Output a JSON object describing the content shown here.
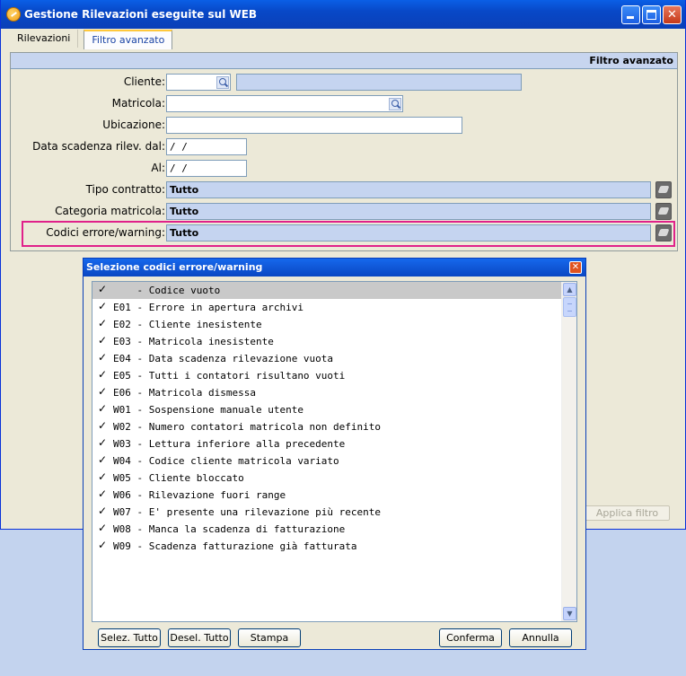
{
  "window": {
    "title": "Gestione Rilevazioni eseguite sul WEB",
    "controls": [
      "minimize",
      "maximize",
      "close"
    ]
  },
  "tabs": [
    {
      "label": "Rilevazioni",
      "active": false
    },
    {
      "label": "Filtro avanzato",
      "active": true
    }
  ],
  "filter_panel": {
    "header": "Filtro avanzato",
    "fields": {
      "cliente": {
        "label": "Cliente:",
        "value": "",
        "description": ""
      },
      "matricola": {
        "label": "Matricola:",
        "value": ""
      },
      "ubicazione": {
        "label": "Ubicazione:",
        "value": ""
      },
      "data_dal": {
        "label": "Data scadenza rilev. dal:",
        "value": "  /  /"
      },
      "al": {
        "label": "Al:",
        "value": "  /  /"
      },
      "tipo_contratto": {
        "label": "Tipo contratto:",
        "value": "Tutto"
      },
      "categoria_matricola": {
        "label": "Categoria matricola:",
        "value": "Tutto"
      },
      "codici_errore": {
        "label": "Codici errore/warning:",
        "value": "Tutto"
      }
    },
    "highlight_color": "#e0218a"
  },
  "apply_button": {
    "label": "Applica filtro",
    "enabled": false
  },
  "dialog": {
    "title": "Selezione codici errore/warning",
    "items": [
      {
        "code": "   ",
        "text": "Codice vuoto",
        "checked": true,
        "selected": true
      },
      {
        "code": "E01",
        "text": "Errore in apertura archivi",
        "checked": true
      },
      {
        "code": "E02",
        "text": "Cliente inesistente",
        "checked": true
      },
      {
        "code": "E03",
        "text": "Matricola inesistente",
        "checked": true
      },
      {
        "code": "E04",
        "text": "Data scadenza rilevazione vuota",
        "checked": true
      },
      {
        "code": "E05",
        "text": "Tutti i contatori risultano vuoti",
        "checked": true
      },
      {
        "code": "E06",
        "text": "Matricola dismessa",
        "checked": true
      },
      {
        "code": "W01",
        "text": "Sospensione manuale utente",
        "checked": true
      },
      {
        "code": "W02",
        "text": "Numero contatori matricola non definito",
        "checked": true
      },
      {
        "code": "W03",
        "text": "Lettura inferiore alla precedente",
        "checked": true
      },
      {
        "code": "W04",
        "text": "Codice cliente matricola variato",
        "checked": true
      },
      {
        "code": "W05",
        "text": "Cliente bloccato",
        "checked": true
      },
      {
        "code": "W06",
        "text": "Rilevazione fuori range",
        "checked": true
      },
      {
        "code": "W07",
        "text": "E' presente una rilevazione più recente",
        "checked": true
      },
      {
        "code": "W08",
        "text": "Manca la scadenza di fatturazione",
        "checked": true
      },
      {
        "code": "W09",
        "text": "Scadenza fatturazione già fatturata",
        "checked": true
      }
    ],
    "buttons": {
      "select_all": "Selez. Tutto",
      "deselect_all": "Desel. Tutto",
      "print": "Stampa",
      "confirm": "Conferma",
      "cancel": "Annulla"
    }
  }
}
